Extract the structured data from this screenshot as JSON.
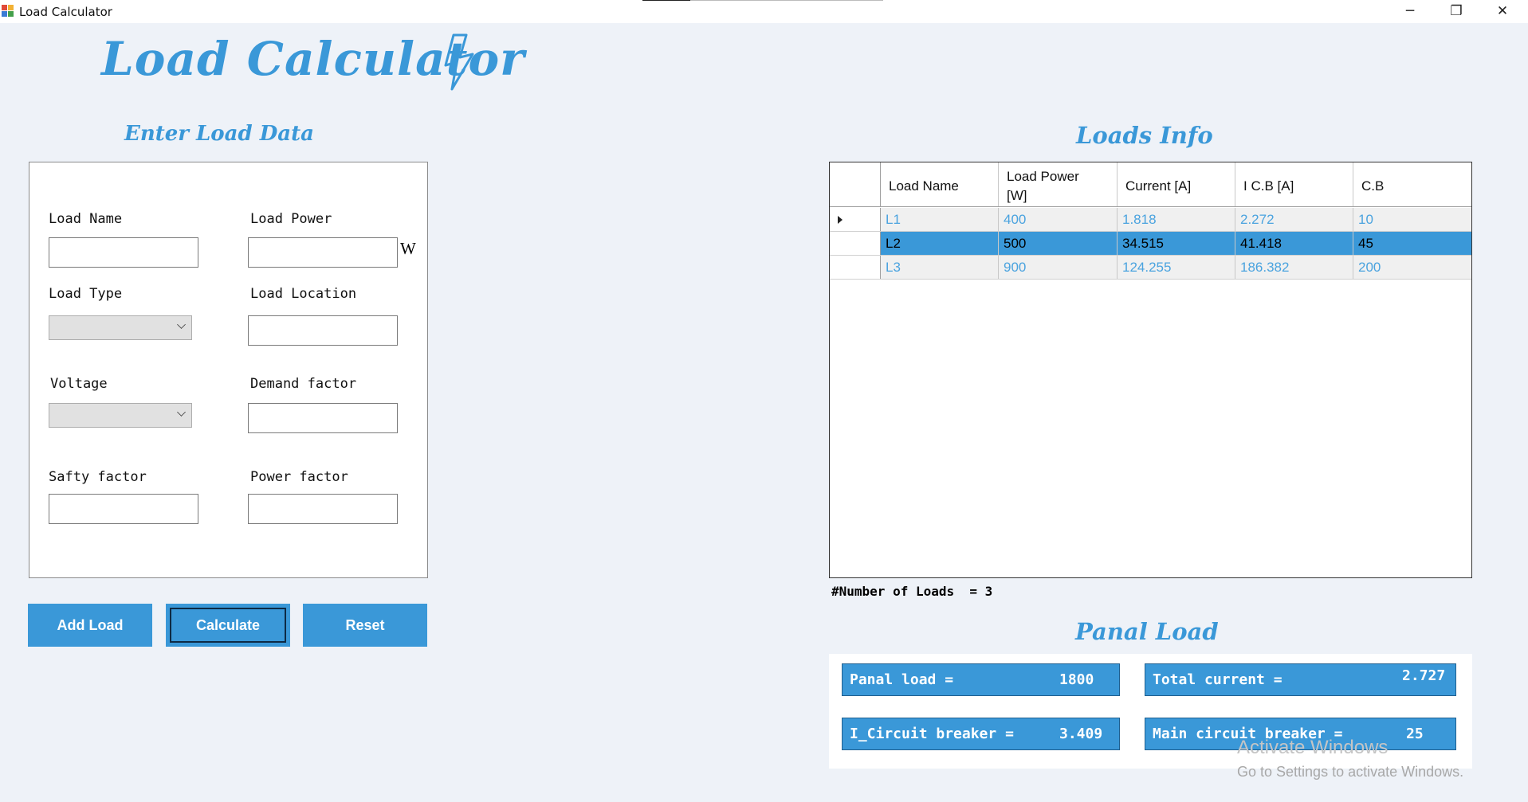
{
  "window": {
    "title": "Load Calculator",
    "minimize": "─",
    "maximize": "❐",
    "close": "✕"
  },
  "app_title": "Load Calculator",
  "form": {
    "heading": "Enter Load Data",
    "load_name_label": "Load Name",
    "load_power_label": "Load Power",
    "power_unit": "W",
    "load_type_label": "Load Type",
    "load_location_label": "Load Location",
    "voltage_label": "Voltage",
    "demand_factor_label": "Demand factor",
    "safety_factor_label": "Safty factor",
    "power_factor_label": "Power factor",
    "values": {
      "load_name": "",
      "load_power": "",
      "load_type": "",
      "load_location": "",
      "voltage": "",
      "demand_factor": "",
      "safety_factor": "",
      "power_factor": ""
    }
  },
  "buttons": {
    "add_load": "Add Load",
    "calculate": "Calculate",
    "reset": "Reset"
  },
  "loads_info": {
    "heading": "Loads Info",
    "columns": [
      "Load Name",
      "Load Power [W]",
      "Current [A]",
      "I C.B [A]",
      "C.B"
    ],
    "rows": [
      [
        "L1",
        "400",
        "1.818",
        "2.272",
        "10"
      ],
      [
        "L2",
        "500",
        "34.515",
        "41.418",
        "45"
      ],
      [
        "L3",
        "900",
        "124.255",
        "186.382",
        "200"
      ]
    ],
    "selected_row": 1,
    "current_row": 0,
    "count_label": "#Number of Loads  = ",
    "count": "3"
  },
  "panal_load": {
    "heading": "Panal Load",
    "panal_load_label": "Panal load =",
    "panal_load_value": "1800",
    "total_current_label": "Total current =",
    "total_current_value": "2.727",
    "icb_label": "I_Circuit breaker =",
    "icb_value": "3.409",
    "main_cb_label": "Main circuit breaker =",
    "main_cb_value": "25"
  },
  "watermark": {
    "line1": "Activate Windows",
    "line2": "Go to Settings to activate Windows."
  },
  "colors": {
    "accent": "#3a98d8",
    "background": "#eef2f8",
    "dark_border": "#0d2a45"
  }
}
